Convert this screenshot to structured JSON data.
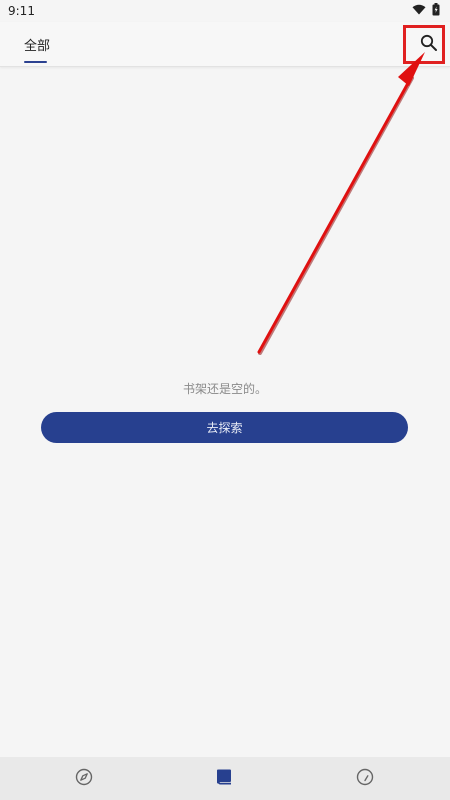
{
  "status_bar": {
    "time": "9:11",
    "icons": [
      "wifi-icon",
      "battery-icon"
    ]
  },
  "header": {
    "tabs": [
      {
        "label": "全部",
        "selected": true
      }
    ],
    "actions": [
      "search-icon"
    ]
  },
  "empty_state": {
    "message": "书架还是空的。",
    "button_label": "去探索"
  },
  "bottom_nav": {
    "items": [
      {
        "icon": "compass-icon",
        "selected": false
      },
      {
        "icon": "book-icon",
        "selected": true
      },
      {
        "icon": "clock-icon",
        "selected": false
      }
    ]
  },
  "colors": {
    "accent": "#27408f",
    "annotation": "#e02020",
    "background": "#f5f5f5",
    "nav_background": "#e9e9e9"
  }
}
